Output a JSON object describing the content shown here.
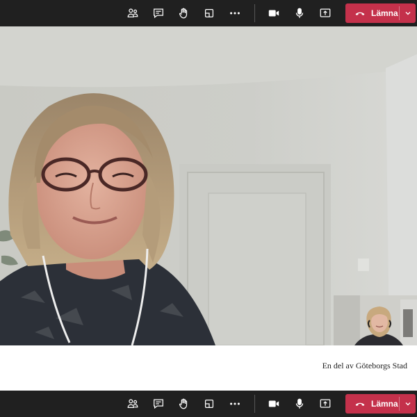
{
  "toolbar_icons": [
    "people-icon",
    "chat-icon",
    "raise-hand-icon",
    "share-tray-icon",
    "more-options-icon",
    "camera-icon",
    "microphone-icon",
    "share-screen-icon"
  ],
  "leave_button": {
    "label": "Lämna",
    "icon": "phone-hangup-icon",
    "color": "#c4314b"
  },
  "footer": {
    "caption": "En del av Göteborgs Stad"
  },
  "colors": {
    "toolbar_bg": "#202020",
    "leave_red": "#c4314b",
    "icon_color": "#ffffff"
  }
}
